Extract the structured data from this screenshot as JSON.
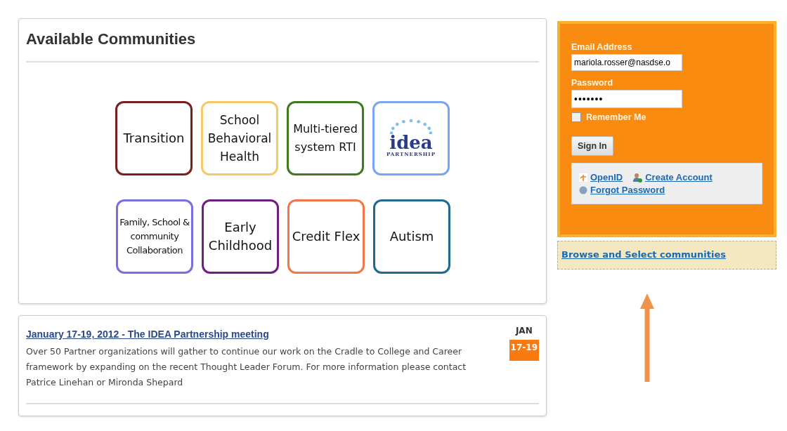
{
  "communities": {
    "title": "Available Communities",
    "tiles": [
      {
        "kind": "text",
        "label": "Transition",
        "color": "#7a1f1f"
      },
      {
        "kind": "text",
        "label": "School Behavioral Health",
        "color": "#f5c96a"
      },
      {
        "kind": "text",
        "label": "Multi-tiered system RTI",
        "color": "#3f7a1f"
      },
      {
        "kind": "logo",
        "label": "idea",
        "sublabel": "PARTNERSHIP",
        "color": "#7aa5f0"
      },
      {
        "kind": "small",
        "label": "Family, School & community Collaboration",
        "color": "#7a6fe0"
      },
      {
        "kind": "text",
        "label": "Early Childhood",
        "color": "#6e1f80"
      },
      {
        "kind": "text",
        "label": "Credit Flex",
        "color": "#f2764a"
      },
      {
        "kind": "text",
        "label": "Autism",
        "color": "#1f6a90"
      }
    ]
  },
  "event": {
    "title": "January 17-19, 2012 - The IDEA Partnership meeting",
    "body": "Over 50 Partner organizations will gather to continue our work on the Cradle to College and Career framework by expanding on the recent Thought Leader Forum.  For more information please contact Patrice Linehan or Mironda Shepard",
    "month": "JAN",
    "days": "17-19"
  },
  "login": {
    "email_label": "Email Address",
    "email": "mariola.rosser@nasdse.o",
    "password_label": "Password",
    "password": "•••••••",
    "remember_label": "Remember Me",
    "remember_checked": false,
    "sign_in": "Sign In",
    "links": {
      "openid": "OpenID",
      "create": "Create Account",
      "forgot": "Forgot Password"
    }
  },
  "browse_link": "Browse and Select communities"
}
